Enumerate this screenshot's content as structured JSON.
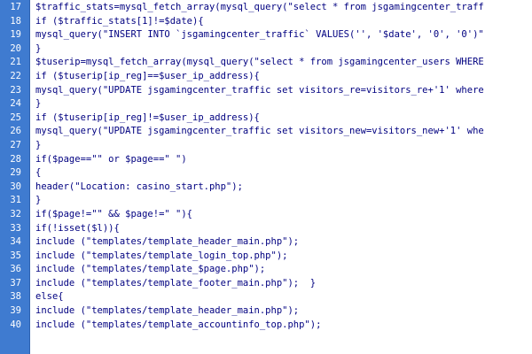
{
  "editor": {
    "lines": [
      {
        "num": "17",
        "text": "$traffic_stats=mysql_fetch_array(mysql_query(\"select * from jsgamingcenter_traff"
      },
      {
        "num": "18",
        "text": "if ($traffic_stats[1]!=$date){"
      },
      {
        "num": "19",
        "text": "mysql_query(\"INSERT INTO `jsgamingcenter_traffic` VALUES('', '$date', '0', '0')\""
      },
      {
        "num": "20",
        "text": "}"
      },
      {
        "num": "21",
        "text": "$tuserip=mysql_fetch_array(mysql_query(\"select * from jsgamingcenter_users WHERE"
      },
      {
        "num": "22",
        "text": "if ($tuserip[ip_reg]==$user_ip_address){"
      },
      {
        "num": "23",
        "text": "mysql_query(\"UPDATE jsgamingcenter_traffic set visitors_re=visitors_re+'1' where"
      },
      {
        "num": "24",
        "text": "}"
      },
      {
        "num": "25",
        "text": "if ($tuserip[ip_reg]!=$user_ip_address){"
      },
      {
        "num": "26",
        "text": "mysql_query(\"UPDATE jsgamingcenter_traffic set visitors_new=visitors_new+'1' whe"
      },
      {
        "num": "27",
        "text": "}"
      },
      {
        "num": "28",
        "text": "if($page==\"\" or $page==\" \")"
      },
      {
        "num": "29",
        "text": "{"
      },
      {
        "num": "30",
        "text": "header(\"Location: casino_start.php\");"
      },
      {
        "num": "31",
        "text": "}"
      },
      {
        "num": "32",
        "text": "if($page!=\"\" && $page!=\" \"){"
      },
      {
        "num": "33",
        "text": "if(!isset($l)){"
      },
      {
        "num": "34",
        "text": "include (\"templates/template_header_main.php\");"
      },
      {
        "num": "35",
        "text": "include (\"templates/template_login_top.php\");"
      },
      {
        "num": "36",
        "text": "include (\"templates/template_$page.php\");"
      },
      {
        "num": "37",
        "text": "include (\"templates/template_footer_main.php\");  }"
      },
      {
        "num": "38",
        "text": "else{"
      },
      {
        "num": "39",
        "text": "include (\"templates/template_header_main.php\");"
      },
      {
        "num": "40",
        "text": "include (\"templates/template_accountinfo_top.php\");"
      }
    ]
  }
}
